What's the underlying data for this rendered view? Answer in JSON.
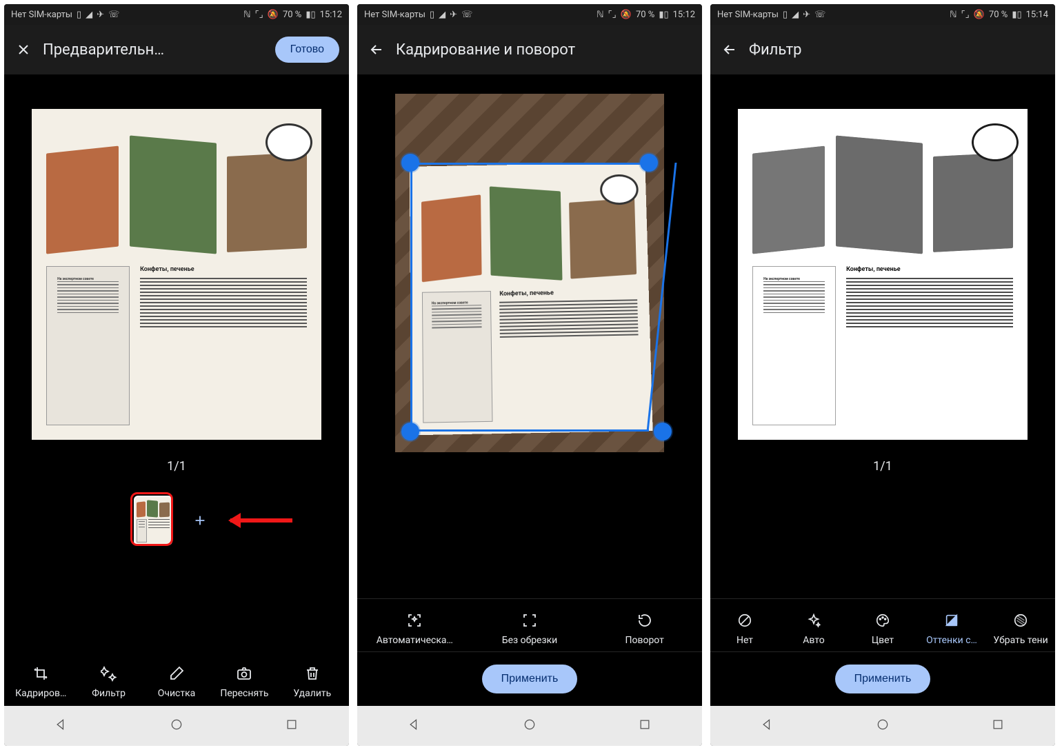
{
  "status": {
    "left_text": "Нет SIM-карты",
    "battery": "70 %",
    "time1": "15:12",
    "time2": "15:12",
    "time3": "15:14"
  },
  "screen1": {
    "title": "Предварительн…",
    "done": "Готово",
    "counter": "1/1",
    "tools": [
      {
        "label": "Кадриров…"
      },
      {
        "label": "Фильтр"
      },
      {
        "label": "Очистка"
      },
      {
        "label": "Переснять"
      },
      {
        "label": "Удалить"
      }
    ]
  },
  "screen2": {
    "title": "Кадрирование и поворот",
    "tools": [
      {
        "label": "Автоматическа…"
      },
      {
        "label": "Без обрезки"
      },
      {
        "label": "Поворот"
      }
    ],
    "apply": "Применить"
  },
  "screen3": {
    "title": "Фильтр",
    "counter": "1/1",
    "tools": [
      {
        "label": "Нет"
      },
      {
        "label": "Авто"
      },
      {
        "label": "Цвет"
      },
      {
        "label": "Оттенки с…",
        "selected": true
      },
      {
        "label": "Убрать тени"
      }
    ],
    "apply": "Применить"
  },
  "doc": {
    "sidebar_title": "На экспертном совете",
    "main_title": "Конфеты, печенье"
  }
}
